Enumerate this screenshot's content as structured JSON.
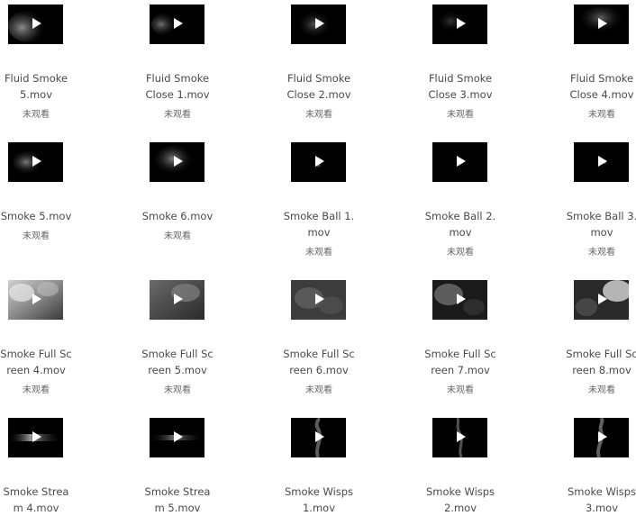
{
  "status_text": "未观看",
  "videos": [
    {
      "title": "Fluid Smoke 5.mov",
      "status": "未观看"
    },
    {
      "title": "Fluid Smoke Close 1.mov",
      "status": "未观看"
    },
    {
      "title": "Fluid Smoke Close 2.mov",
      "status": "未观看"
    },
    {
      "title": "Fluid Smoke Close 3.mov",
      "status": "未观看"
    },
    {
      "title": "Fluid Smoke Close 4.mov",
      "status": "未观看"
    },
    {
      "title": "Smoke 5.mov",
      "status": "未观看"
    },
    {
      "title": "Smoke 6.mov",
      "status": "未观看"
    },
    {
      "title": "Smoke Ball 1.mov",
      "status": "未观看"
    },
    {
      "title": "Smoke Ball 2.mov",
      "status": "未观看"
    },
    {
      "title": "Smoke Ball 3.mov",
      "status": "未观看"
    },
    {
      "title": "Smoke Full Screen 4.mov",
      "status": "未观看"
    },
    {
      "title": "Smoke Full Screen 5.mov",
      "status": "未观看"
    },
    {
      "title": "Smoke Full Screen 6.mov",
      "status": "未观看"
    },
    {
      "title": "Smoke Full Screen 7.mov",
      "status": "未观看"
    },
    {
      "title": "Smoke Full Screen 8.mov",
      "status": "未观看"
    },
    {
      "title": "Smoke Stream 4.mov",
      "status": ""
    },
    {
      "title": "Smoke Stream 5.mov",
      "status": ""
    },
    {
      "title": "Smoke Wisps 1.mov",
      "status": ""
    },
    {
      "title": "Smoke Wisps 2.mov",
      "status": ""
    },
    {
      "title": "Smoke Wisps 3.mov",
      "status": ""
    }
  ],
  "icons": {
    "play": "play-icon",
    "thumbnail": "smoke-thumbnail"
  },
  "colors": {
    "thumbnail_bg": "#000000",
    "title_text": "#4a4a4a",
    "status_text": "#666666"
  }
}
